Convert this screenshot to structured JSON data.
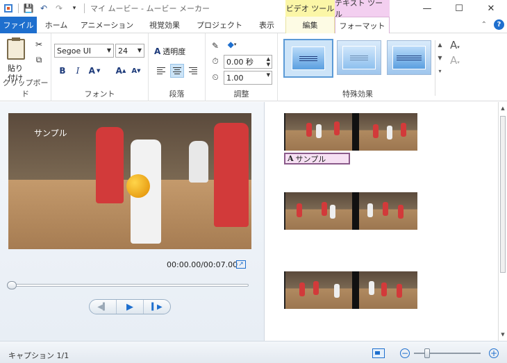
{
  "window": {
    "title": "マイ ムービー - ムービー メーカー",
    "controls": {
      "minimize": "—",
      "maximize": "☐",
      "close": "✕"
    }
  },
  "qat": {
    "save": "💾",
    "undo": "↶",
    "redo": "↷",
    "more": "▾"
  },
  "context_groups": {
    "video_tools": "ビデオ ツール",
    "text_tools": "テキスト ツール"
  },
  "tabs": {
    "file": "ファイル",
    "home": "ホーム",
    "animation": "アニメーション",
    "visual_effects": "視覚効果",
    "project": "プロジェクト",
    "view": "表示",
    "edit": "編集",
    "format": "フォーマット"
  },
  "ribbon": {
    "clipboard": {
      "paste_label_1": "貼り",
      "paste_label_2": "付け",
      "group": "クリップボード"
    },
    "font": {
      "family": "Segoe UI",
      "size": "24",
      "transparency_label": "透明度",
      "bold": "B",
      "italic": "I",
      "color": "A",
      "grow": "A",
      "shrink": "A",
      "group": "フォント"
    },
    "paragraph": {
      "group": "段落"
    },
    "adjust": {
      "start_time": "0.00 秒",
      "duration": "1.00",
      "group": "調整"
    },
    "effects": {
      "group": "特殊効果",
      "text_style_1": "A",
      "text_style_2": "A"
    }
  },
  "preview": {
    "caption": "サンプル",
    "timecode": "00:00.00/00:07.00",
    "seek_position": 0.0
  },
  "storyboard": {
    "caption_clip": "サンプル",
    "caption_glyph": "A"
  },
  "status": {
    "caption_count": "キャプション 1/1",
    "zoom_out": "−",
    "zoom_in": "+",
    "zoom_level": 0.16
  },
  "colors": {
    "accent": "#1e6fce",
    "video_tools": "#fbf6a7",
    "text_tools": "#f3cff0"
  }
}
